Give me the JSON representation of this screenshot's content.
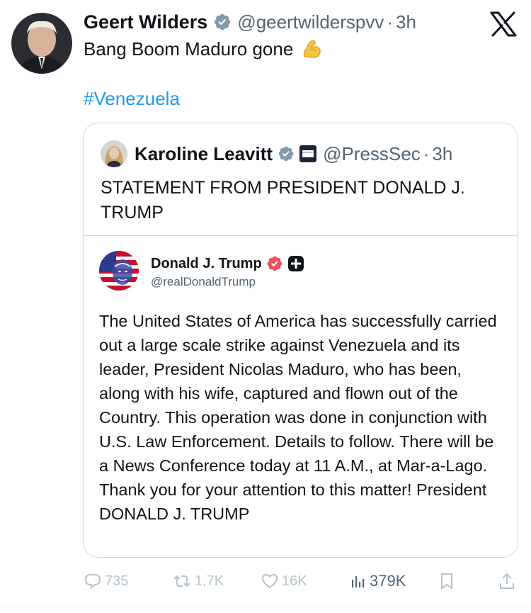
{
  "post": {
    "author_name": "Geert Wilders",
    "author_handle": "@geertwilderspvv",
    "time": "3h",
    "separator": "·",
    "text": "Bang Boom Maduro gone",
    "emoji": "flexed-biceps",
    "hashtag": "#Venezuela"
  },
  "quote": {
    "author_name": "Karoline Leavitt",
    "author_handle": "@PressSec",
    "separator": "·",
    "time": "3h",
    "affiliate_badge_text": "WHITE HOUSE",
    "text": "STATEMENT FROM PRESIDENT DONALD J. TRUMP"
  },
  "nested": {
    "author_name": "Donald J. Trump",
    "author_handle": "@realDonaldTrump",
    "text": "The United States of America has successfully carried out a large scale strike against Venezuela and its leader, President Nicolas Maduro, who has been, along with his wife, captured and flown out of the Country. This operation was done in conjunction with U.S. Law Enforcement. Details to follow. There will be a News Conference today at 11 A.M., at Mar-a-Lago. Thank you for your attention to this matter! President DONALD J. TRUMP"
  },
  "actions": {
    "replies": "735",
    "reposts": "1,7K",
    "likes": "16K",
    "views": "379K"
  },
  "colors": {
    "verified_blue": "#1d9bf0",
    "verified_gold": "#e0245e",
    "text": "#0f1419",
    "secondary": "#536471",
    "link": "#1d9bf0",
    "border": "#cfd9de"
  }
}
